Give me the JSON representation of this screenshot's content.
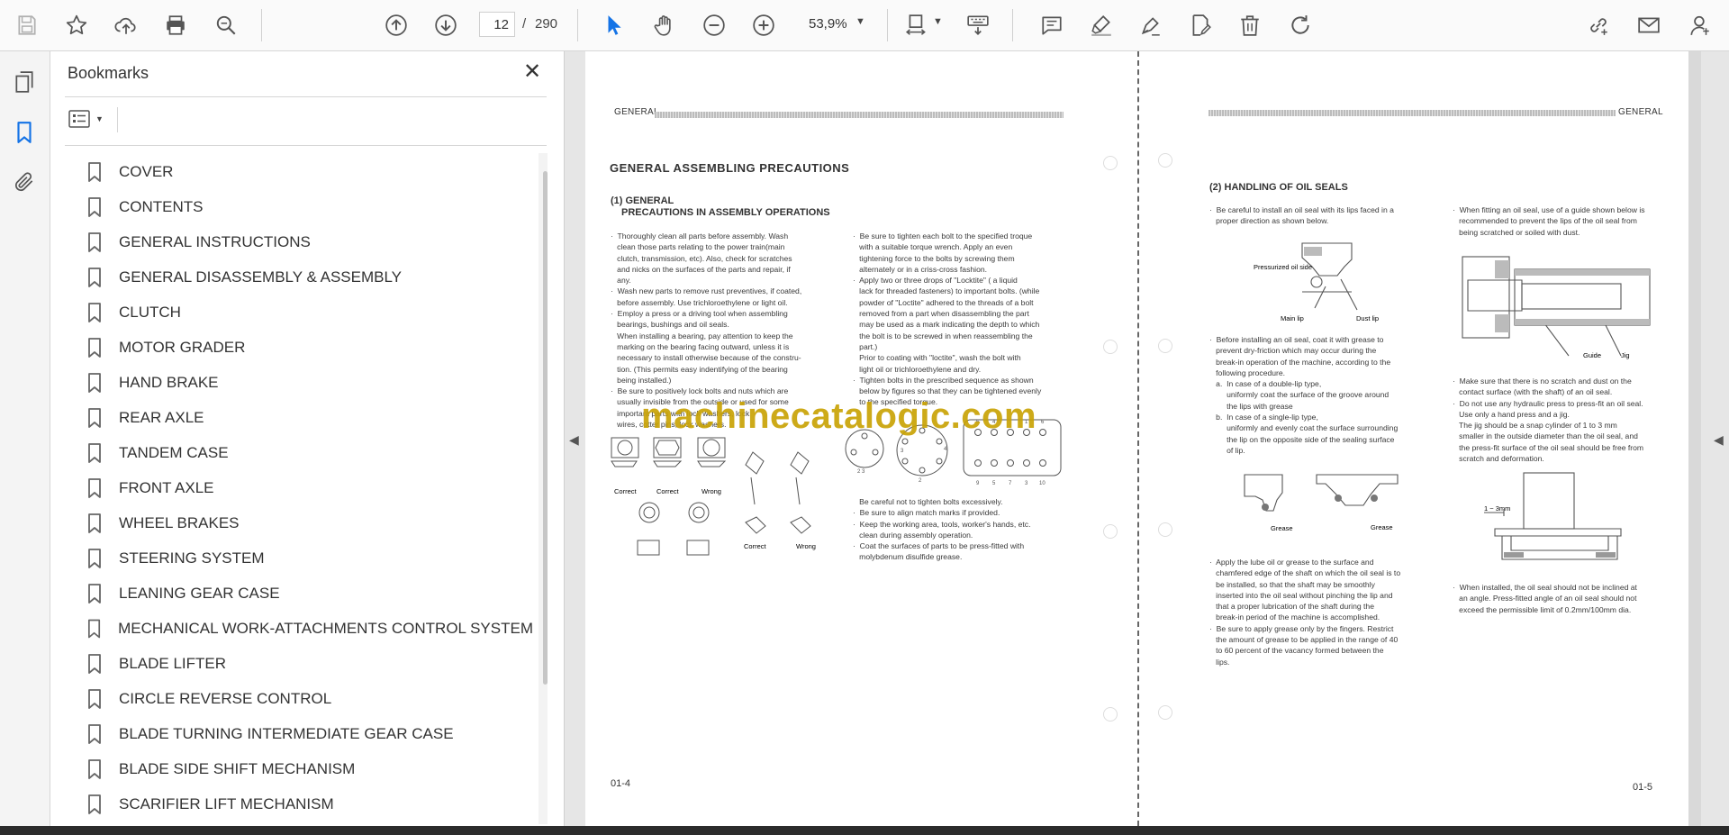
{
  "toolbar": {
    "page_current": "12",
    "page_sep": "/",
    "page_total": "290",
    "zoom": "53,9%"
  },
  "bookmarks": {
    "title": "Bookmarks",
    "items": [
      {
        "label": "COVER"
      },
      {
        "label": "CONTENTS"
      },
      {
        "label": "GENERAL INSTRUCTIONS"
      },
      {
        "label": "GENERAL DISASSEMBLY & ASSEMBLY"
      },
      {
        "label": "CLUTCH"
      },
      {
        "label": "MOTOR GRADER"
      },
      {
        "label": "HAND BRAKE"
      },
      {
        "label": "REAR AXLE"
      },
      {
        "label": "TANDEM CASE"
      },
      {
        "label": "FRONT AXLE"
      },
      {
        "label": "WHEEL BRAKES"
      },
      {
        "label": "STEERING SYSTEM"
      },
      {
        "label": "LEANING GEAR CASE"
      },
      {
        "label": "MECHANICAL WORK-ATTACHMENTS CONTROL SYSTEM"
      },
      {
        "label": "BLADE LIFTER"
      },
      {
        "label": "CIRCLE REVERSE CONTROL"
      },
      {
        "label": "BLADE TURNING INTERMEDIATE GEAR CASE"
      },
      {
        "label": "BLADE SIDE SHIFT MECHANISM"
      },
      {
        "label": "SCARIFIER LIFT MECHANISM"
      }
    ]
  },
  "left_page": {
    "header": "GENERAL",
    "title": "GENERAL  ASSEMBLING  PRECAUTIONS",
    "section_num": "(1) GENERAL",
    "section_title": "PRECAUTIONS IN ASSEMBLY OPERATIONS",
    "col1": [
      "·  Thoroughly clean all parts before assembly. Wash",
      "   clean those parts relating to the power train(main",
      "   clutch, transmission, etc). Also, check for scratches",
      "   and nicks on the surfaces of the parts and repair, if",
      "   any.",
      "·  Wash new parts to remove rust preventives, if coated,",
      "   before assembly. Use trichloroethylene or light oil.",
      "·  Employ a press or a driving tool when assembling",
      "   bearings, bushings and oil seals.",
      "   When installing a bearing, pay attention to keep the",
      "   marking on the bearing facing outward, unless it is",
      "   necessary to install otherwise because of the constru-",
      "   tion. (This permits easy indentifying of the bearing",
      "   being installed.)",
      "·  Be sure to positively lock bolts and nuts which are",
      "   usually invisible from the outside or used for some",
      "   important parts with lock washers, lock",
      "   wires, cotter pins, lock washers."
    ],
    "col2": [
      "·  Be sure to tighten each bolt to the specified troque",
      "   with a suitable torque wrench. Apply an even",
      "   tightening force to the bolts by screwing them",
      "   alternately or in a criss-cross fashion.",
      "·  Apply two or three drops of \"Locktite\" ( a liquid",
      "   lack for threaded fasteners) to important bolts. (while",
      "   powder of \"Loctite\" adhered to the threads of a bolt",
      "   removed from a part when disassembling the part",
      "   may be used as a mark indicating the depth to which",
      "   the bolt is to be screwed in when reassembling the",
      "   part.)",
      "   Prior to coating with \"loctite\", wash the bolt with",
      "   light oil or trichloroethylene and dry.",
      "·  Tighten bolts in the prescribed sequence as shown",
      "   below by figures so that they can be tightened evenly",
      "   to the specified torque."
    ],
    "col2b": [
      "   Be careful not to tighten bolts excessively.",
      "·  Be sure to align match marks if provided.",
      "·  Keep the working area, tools, worker's hands, etc.",
      "   clean during assembly operation.",
      "·  Coat the surfaces of parts to be press-fitted with",
      "   molybdenum disulfide grease."
    ],
    "captions": {
      "correct1": "Correct",
      "correct2": "Correct",
      "wrong1": "Wrong",
      "correct3": "Correct",
      "wrong2": "Wrong"
    },
    "page_number": "01-4"
  },
  "right_page": {
    "header": "GENERAL",
    "section_title": "(2) HANDLING OF OIL SEALS",
    "col1a": [
      "·  Be careful to install an oil seal with its lips faced in a",
      "   proper direction as shown below."
    ],
    "fig1": {
      "pressurized": "Pressurized oil side",
      "main_lip": "Main lip",
      "dust_lip": "Dust lip"
    },
    "col1b": [
      "·  Before installing an oil seal, coat it with grease to",
      "   prevent dry-friction which may occur during the",
      "   break-in operation of the machine, according to the",
      "   following procedure.",
      "   a.  In case of a double-lip type,",
      "        uniformly coat the surface of the groove around",
      "        the lips with grease",
      "   b.  In case of a single-lip type,",
      "        uniformly and evenly coat the surface surrounding",
      "        the lip on the opposite side of the sealing surface",
      "        of lip."
    ],
    "fig2": {
      "grease1": "Grease",
      "grease2": "Grease"
    },
    "col1c": [
      "·  Apply the lube oil or grease to the surface and",
      "   chamfered edge of the shaft on which the oil seal is to",
      "   be installed, so that the shaft may be smoothly",
      "   inserted into the oil seal without pinching the lip and",
      "   that a proper lubrication of the shaft during the",
      "   break-in period of the machine is accomplished.",
      "·  Be sure to apply grease only by the fingers. Restrict",
      "   the amount of grease to be applied in the range of 40",
      "   to 60 percent of the vacancy formed between the",
      "   lips."
    ],
    "col2a": [
      "·  When fitting an oil seal, use of a guide shown below is",
      "   recommended to prevent the lips of the oil seal from",
      "   being scratched or soiled with dust."
    ],
    "fig3": {
      "guide": "Guide",
      "jig": "Jig"
    },
    "col2b": [
      "·  Make sure that there is no scratch and dust on the",
      "   contact surface (with the shaft) of an oil seal.",
      "·  Do not use any hydraulic press to press-fit an oil seal.",
      "   Use only a hand press and a jig.",
      "   The jig should be a snap cylinder of 1 to 3 mm",
      "   smaller in the outside diameter than the oil seal, and",
      "   the press-fit surface of the oil seal should be free from",
      "   scratch and deformation."
    ],
    "fig4": {
      "dim": "1 ~ 3mm"
    },
    "col2c": [
      "·  When installed, the oil seal should not be inclined at",
      "   an angle. Press-fitted angle of an oil seal should not",
      "   exceed the permissible limit of 0.2mm/100mm dia."
    ],
    "page_number": "01-5"
  },
  "watermark": "machinecatalogic.com"
}
